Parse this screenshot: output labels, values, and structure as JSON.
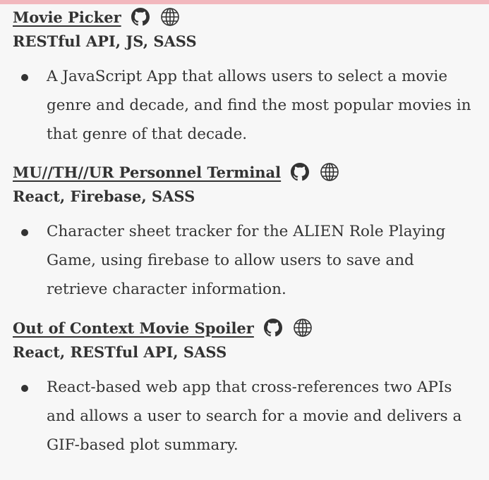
{
  "projects": [
    {
      "title": "Movie Picker",
      "tech": "RESTful API, JS, SASS",
      "description": "A JavaScript App that allows users to select a movie genre and decade, and find the most popular movies in that genre of that decade.",
      "icons": [
        "github-icon",
        "globe-icon"
      ]
    },
    {
      "title": "MU//TH//UR Personnel Terminal",
      "tech": "React, Firebase, SASS",
      "description": "Character sheet tracker for the ALIEN Role Playing Game, using firebase to allow users to save and retrieve character information.",
      "icons": [
        "github-icon",
        "globe-icon"
      ]
    },
    {
      "title": "Out of Context Movie Spoiler",
      "tech": "React, RESTful API, SASS",
      "description": "React-based web app that cross-references two APIs and allows a user to search for a movie and delivers a GIF-based plot summary.",
      "icons": [
        "github-icon",
        "globe-icon"
      ]
    }
  ],
  "colors": {
    "text": "#333333",
    "background": "#f7f7f7",
    "accent_bar": "#f2b8be"
  }
}
